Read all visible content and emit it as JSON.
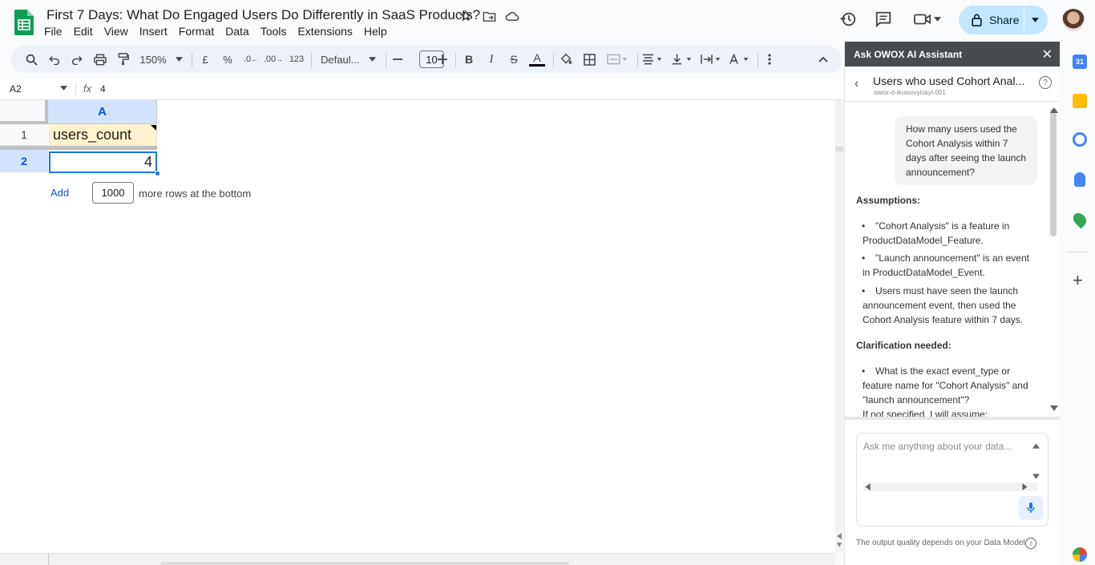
{
  "doc": {
    "title": "First 7 Days: What Do Engaged Users Do Differently in SaaS Products?"
  },
  "menu": [
    "File",
    "Edit",
    "View",
    "Insert",
    "Format",
    "Data",
    "Tools",
    "Extensions",
    "Help"
  ],
  "share": {
    "label": "Share"
  },
  "toolbar": {
    "zoom": "150%",
    "currency": "£",
    "percent": "%",
    "dec_decrease": ".0",
    "dec_increase": ".00",
    "number_format": "123",
    "font": "Defaul...",
    "font_size": "10"
  },
  "formula_bar": {
    "cell_ref": "A2",
    "fx": "fx",
    "value": "4"
  },
  "sheet": {
    "column_headers": [
      "A"
    ],
    "row_numbers": [
      "1",
      "2"
    ],
    "cells": {
      "A1": "users_count",
      "A2": "4"
    },
    "add_rows": {
      "add_label": "Add",
      "count": "1000",
      "suffix": "more rows at the bottom"
    }
  },
  "panel": {
    "header": "Ask OWOX AI Assistant",
    "close": "✕",
    "title": "Users who used Cohort Anal...",
    "subtitle": "owox-d-ikrasovytskyi-001",
    "question": "How many users used the Cohort Analysis within 7 days after seeing the launch announcement?",
    "assumptions_title": "Assumptions:",
    "assumptions": [
      "\"Cohort Analysis\" is a feature in ProductDataModel_Feature.",
      "\"Launch announcement\" is an event in ProductDataModel_Event.",
      "Users must have seen the launch announcement event, then used the Cohort Analysis feature within 7 days."
    ],
    "clarification_title": "Clarification needed:",
    "clarifications": [
      "What is the exact event_type or feature name for \"Cohort Analysis\" and \"launch announcement\"?"
    ],
    "trailing_text": "If not specified, I will assume:",
    "input_placeholder": "Ask me anything about your data...",
    "footer": "The output quality depends on your Data Model"
  },
  "colors": {
    "accent": "#0b57d0",
    "share_bg": "#c2e7ff",
    "panel_header_bg": "#474c51",
    "selected_col": "#d3e3fd",
    "header_cell": "#fff2cc"
  }
}
